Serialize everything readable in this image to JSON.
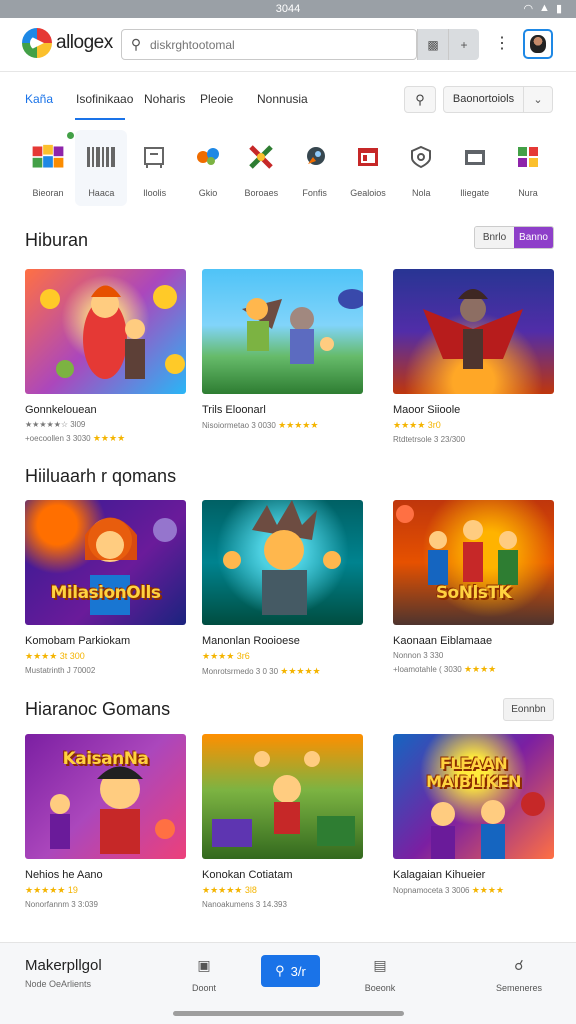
{
  "statusbar": {
    "time": "3044"
  },
  "header": {
    "brand": "allogex",
    "search_placeholder": "diskrghtootomal",
    "search_btn_plus": "+"
  },
  "tabs": {
    "items": [
      "Kaña",
      "Isofinikaao",
      "Noharis",
      "Pleoie",
      "Nonnusia"
    ],
    "select_label": "Baonortoiols"
  },
  "categories": [
    {
      "label": "Bieoran"
    },
    {
      "label": "Haaca"
    },
    {
      "label": "Iloolis"
    },
    {
      "label": "Gkio"
    },
    {
      "label": "Boroaes"
    },
    {
      "label": "Fonfis"
    },
    {
      "label": "Gealoios"
    },
    {
      "label": "Nola"
    },
    {
      "label": "Iliegate"
    },
    {
      "label": "Nura"
    }
  ],
  "sections": [
    {
      "title": "Hiburan",
      "toggle": [
        "Bnrlo",
        "Banno"
      ],
      "cards": [
        {
          "name": "Gonnkelouean",
          "meta": "★★★★★☆ 3l09",
          "meta2": "+oecoollen 3 3030",
          "stars2": "★★★★"
        },
        {
          "name": "Trils Eloonarl",
          "meta": "Nisoiormetao 3 0030",
          "stars2": "★★★★★"
        },
        {
          "name": "Maoor Siioole",
          "meta": "★★★★ 3r0",
          "meta2": "Rtdtetrsole 3 23/300"
        }
      ]
    },
    {
      "title": "Hiiluaarh r qomans",
      "cards": [
        {
          "name": "Komobam Parkiokam",
          "meta": "★★★★ 3t 300",
          "meta2": "Mustatrinth J 70002",
          "overlay": "MilasionOlls"
        },
        {
          "name": "Manonlan Rooioese",
          "meta": "★★★★ 3r6",
          "meta2": "Monrotsrmedo 3 0 30",
          "stars2": "★★★★★",
          "overlay": ""
        },
        {
          "name": "Kaonaan Eiblamaae",
          "meta": "Nonnon 3 330",
          "meta2": "+loamotahle ( 3030",
          "stars2": "★★★★",
          "overlay": "SoNlsTK"
        }
      ]
    },
    {
      "title": "Hiaranoc Gomans",
      "more": "Eonnbn",
      "cards": [
        {
          "name": "Nehios he Aano",
          "meta": "★★★★★ 19",
          "meta2": "Nonorfannm 3 3:039",
          "overlay": "KaisanNa"
        },
        {
          "name": "Konokan Cotiatam",
          "meta": "★★★★★ 3l8",
          "meta2": "Nanoakumens 3 14.393",
          "overlay": ""
        },
        {
          "name": "Kalagaian Kihueier",
          "meta": "Nopnamoceta 3 3006",
          "stars2": "★★★★",
          "overlay": "FLEAAN MAIBLIKEN"
        }
      ]
    }
  ],
  "bottomnav": {
    "title": "Makerpllgol",
    "subtitle": "Node OeArlients",
    "items": [
      "Doont",
      "",
      "Boeonk",
      "Semeneres"
    ],
    "center_label": "3/r"
  }
}
